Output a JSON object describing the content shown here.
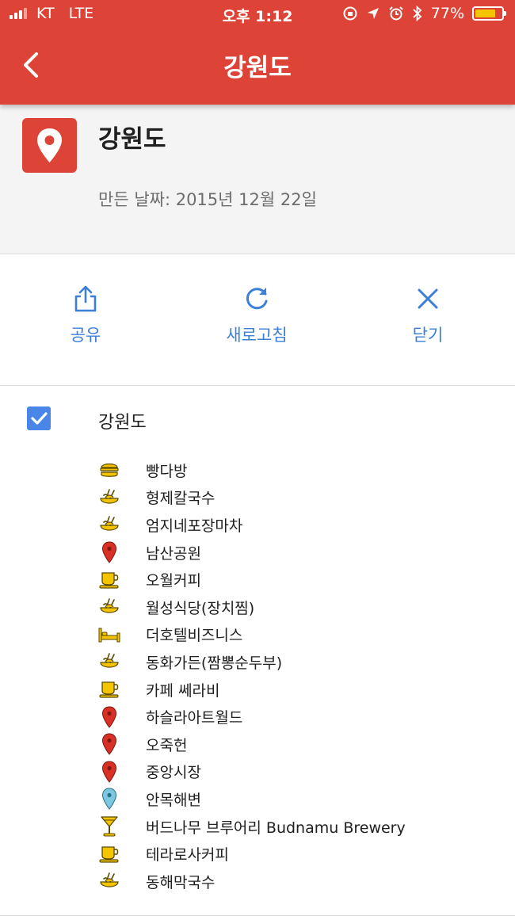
{
  "status_bar": {
    "carrier": "KT",
    "network": "LTE",
    "time": "오후 1:12",
    "battery": "77%",
    "battery_level": 0.77
  },
  "app_bar": {
    "title": "강원도",
    "back_icon": "chevron-left-icon"
  },
  "map_header": {
    "icon": "map-pin-icon",
    "title": "강원도",
    "created": "만든 날짜: 2015년 12월 22일"
  },
  "actions": [
    {
      "label": "공유",
      "icon": "share-icon"
    },
    {
      "label": "새로고침",
      "icon": "refresh-icon"
    },
    {
      "label": "닫기",
      "icon": "close-icon"
    }
  ],
  "layer": {
    "title": "강원도",
    "checked": true,
    "places": [
      {
        "name": "빵다방",
        "icon": "burger-icon"
      },
      {
        "name": "형제칼국수",
        "icon": "noodle-hand-icon"
      },
      {
        "name": "엄지네포장마차",
        "icon": "noodle-hand-icon"
      },
      {
        "name": "남산공원",
        "icon": "red-pin-icon"
      },
      {
        "name": "오월커피",
        "icon": "coffee-cup-icon"
      },
      {
        "name": "월성식당(장치찜)",
        "icon": "noodle-hand-icon"
      },
      {
        "name": "더호텔비즈니스",
        "icon": "hotel-bed-icon"
      },
      {
        "name": "동화가든(짬뽕순두부)",
        "icon": "noodle-hand-icon"
      },
      {
        "name": "카페 쎄라비",
        "icon": "coffee-cup-icon"
      },
      {
        "name": "하슬라아트월드",
        "icon": "red-pin-icon"
      },
      {
        "name": "오죽헌",
        "icon": "red-pin-icon"
      },
      {
        "name": "중앙시장",
        "icon": "red-pin-icon"
      },
      {
        "name": "안목해변",
        "icon": "blue-pin-icon"
      },
      {
        "name": "버드나무 브루어리 Budnamu Brewery",
        "icon": "cocktail-icon"
      },
      {
        "name": "테라로사커피",
        "icon": "coffee-cup-icon"
      },
      {
        "name": "동해막국수",
        "icon": "noodle-hand-icon"
      }
    ]
  },
  "colors": {
    "brand_red": "#dd4437",
    "action_blue": "#3b7fd9",
    "checkbox_blue": "#4a86e8",
    "icon_yellow": "#f5c400",
    "pin_red": "#d93025",
    "pin_blue": "#7cc8e0"
  }
}
